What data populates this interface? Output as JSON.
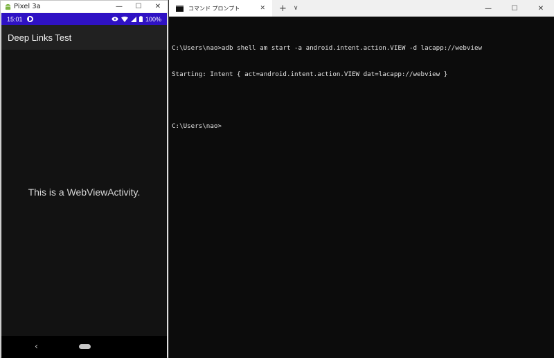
{
  "emulator": {
    "window_title": "Pixel 3a",
    "controls": {
      "minimize": "—",
      "maximize": "☐",
      "close": "✕"
    },
    "status_bar": {
      "time": "15:01",
      "battery": "100%"
    },
    "app_title": "Deep Links Test",
    "content_text": "This is a WebViewActivity.",
    "nav": {
      "back": "‹"
    },
    "colors": {
      "status_bar": "#2f12c4",
      "app_bar": "#212121",
      "background": "#121212"
    }
  },
  "terminal": {
    "tab_title": "コマンド プロンプト",
    "tab_close": "✕",
    "new_tab": "+",
    "tab_dropdown": "∨",
    "controls": {
      "minimize": "—",
      "maximize": "☐",
      "close": "✕"
    },
    "lines": [
      "C:\\Users\\nao>adb shell am start -a android.intent.action.VIEW -d lacapp://webview",
      "Starting: Intent { act=android.intent.action.VIEW dat=lacapp://webview }",
      "",
      "C:\\Users\\nao>"
    ]
  }
}
